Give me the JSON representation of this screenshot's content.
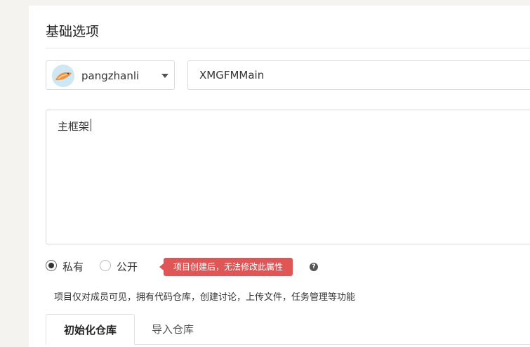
{
  "section": {
    "title": "基础选项"
  },
  "owner": {
    "name": "pangzhanli",
    "avatar_icon": "fox-avatar-icon"
  },
  "repo": {
    "name": "XMGFMMain"
  },
  "description": {
    "value": "主框架"
  },
  "visibility": {
    "private_label": "私有",
    "public_label": "公开",
    "selected": "private",
    "tooltip": "项目创建后，无法修改此属性",
    "help_icon": "?",
    "note": "项目仅对成员可见，拥有代码仓库，创建讨论，上传文件，任务管理等功能"
  },
  "tabs": [
    {
      "label": "初始化仓库",
      "active": true
    },
    {
      "label": "导入仓库",
      "active": false
    }
  ],
  "colors": {
    "tooltip": "#e05555",
    "background": "#f4f3ef"
  }
}
